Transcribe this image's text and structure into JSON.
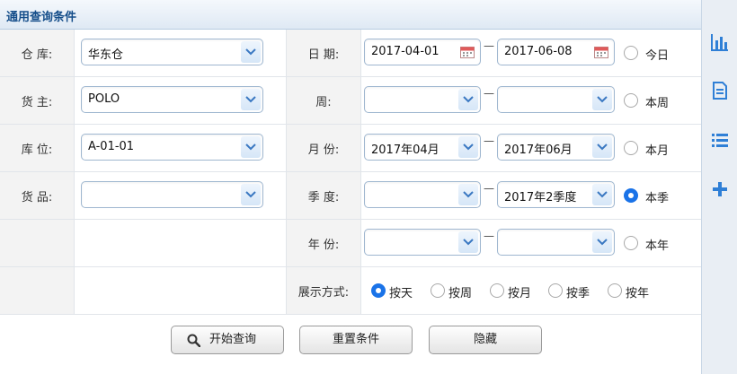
{
  "panel": {
    "title": "通用查询条件"
  },
  "rows": {
    "warehouse": {
      "label": "仓 库:",
      "value": "华东仓"
    },
    "owner": {
      "label": "货 主:",
      "value": "POLO"
    },
    "location": {
      "label": "库 位:",
      "value": "A-01-01"
    },
    "goods": {
      "label": "货 品:",
      "value": ""
    },
    "date": {
      "label": "日 期:",
      "from": "2017-04-01",
      "to": "2017-06-08",
      "radio": "今日",
      "radio_checked": false
    },
    "week": {
      "label": "周:",
      "from": "",
      "to": "",
      "radio": "本周",
      "radio_checked": false
    },
    "month": {
      "label": "月 份:",
      "from": "2017年04月",
      "to": "2017年06月",
      "radio": "本月",
      "radio_checked": false
    },
    "quarter": {
      "label": "季 度:",
      "from": "",
      "to": "2017年2季度",
      "radio": "本季",
      "radio_checked": true
    },
    "year": {
      "label": "年 份:",
      "from": "",
      "to": "",
      "radio": "本年",
      "radio_checked": false
    },
    "display": {
      "label": "展示方式:",
      "options": [
        "按天",
        "按周",
        "按月",
        "按季",
        "按年"
      ],
      "selected": "按天"
    }
  },
  "buttons": {
    "search": "开始查询",
    "reset": "重置条件",
    "hide": "隐藏"
  },
  "sidebar": {
    "icons": [
      "bar-chart-icon",
      "document-icon",
      "list-icon",
      "plus-icon"
    ]
  },
  "colors": {
    "accent": "#1a73e8",
    "title_text": "#154e8a",
    "border": "#9fb7d0",
    "sidebar_icon": "#2f7fd6"
  }
}
